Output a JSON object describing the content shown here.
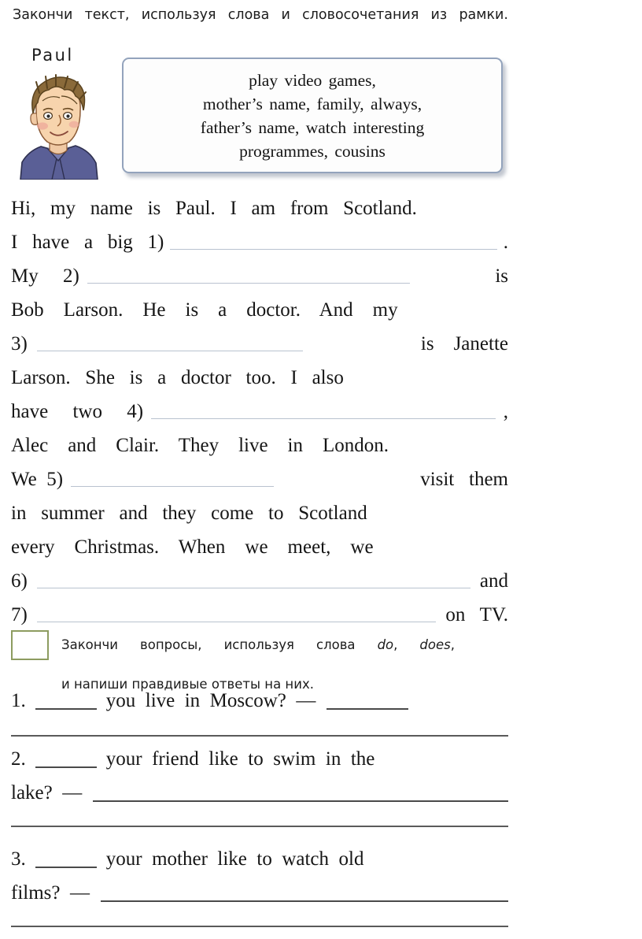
{
  "task1": {
    "instruction": "Закончи текст, используя слова и словосочетания из рамки.",
    "character_name": "Paul",
    "character_icon": "boy-portrait-icon",
    "word_bank": [
      "play  video  games,",
      "mother’s  name,  family,  always,",
      "father’s  name,  watch  interesting",
      "programmes,  cousins"
    ],
    "passage_lines": [
      {
        "id": "line-1",
        "before": "Hi,   my   name   is   Paul.   I   am   from   Scotland.",
        "blank": null,
        "after": ""
      },
      {
        "id": "line-2",
        "before": "I   have   a   big   1)",
        "blank": "fixed",
        "after": "."
      },
      {
        "id": "line-3",
        "before": "My     2)",
        "blank": "grow",
        "after": "is"
      },
      {
        "id": "line-4",
        "before": "Bob    Larson.    He    is    a    doctor.    And    my",
        "blank": null,
        "after": ""
      },
      {
        "id": "line-5",
        "before": "3)",
        "blank": "grow",
        "after": "is    Janette"
      },
      {
        "id": "line-6",
        "before": "Larson.   She   is   a   doctor   too.   I   also",
        "blank": null,
        "after": ""
      },
      {
        "id": "line-7",
        "before": "have     two     4)",
        "blank": "grow",
        "after": ","
      },
      {
        "id": "line-8",
        "before": "Alec    and    Clair.    They    live    in    London.",
        "blank": null,
        "after": ""
      },
      {
        "id": "line-9",
        "before": "We  5)",
        "blank": "grow",
        "after": "visit   them"
      },
      {
        "id": "line-10",
        "before": "in   summer   and   they   come   to   Scotland",
        "blank": null,
        "after": ""
      },
      {
        "id": "line-11",
        "before": "every    Christmas.    When    we    meet,    we",
        "blank": null,
        "after": ""
      },
      {
        "id": "line-12",
        "before": "6)",
        "blank": "grow",
        "after": "and"
      },
      {
        "id": "line-13",
        "before": "7)",
        "blank": "grow",
        "after": "on   TV."
      }
    ]
  },
  "task2": {
    "number_box": "",
    "instruction_line1_pre": "Закончи вопросы, используя слова ",
    "instruction_line1_em1": "do",
    "instruction_line1_mid": ", ",
    "instruction_line1_em2": "does",
    "instruction_line1_post": ",",
    "instruction_line2": "и напиши правдивые ответы на них.",
    "questions": [
      {
        "id": "question-1",
        "number": "1.",
        "text_after_blank": "you  live  in  Moscow?  —",
        "has_trailing_blank": true,
        "answer_rules": 1
      },
      {
        "id": "question-2",
        "number": "2.",
        "text_after_blank": "your  friend  like  to  swim  in  the",
        "continuation": "lake?  —",
        "has_trailing_blank": true,
        "answer_rules": 1
      },
      {
        "id": "question-3",
        "number": "3.",
        "text_after_blank": "your  mother  like  to  watch  old",
        "continuation": "films?  —",
        "has_trailing_blank": true,
        "answer_rules": 1
      }
    ]
  },
  "colors": {
    "page_background": "#ffffff",
    "text": "#151515",
    "wordbox_border": "#93a3bc",
    "greenbox_border": "#8d9c60",
    "passage_blank_rule": "#b9c2cf",
    "question_rule": "#4a4a4a"
  }
}
